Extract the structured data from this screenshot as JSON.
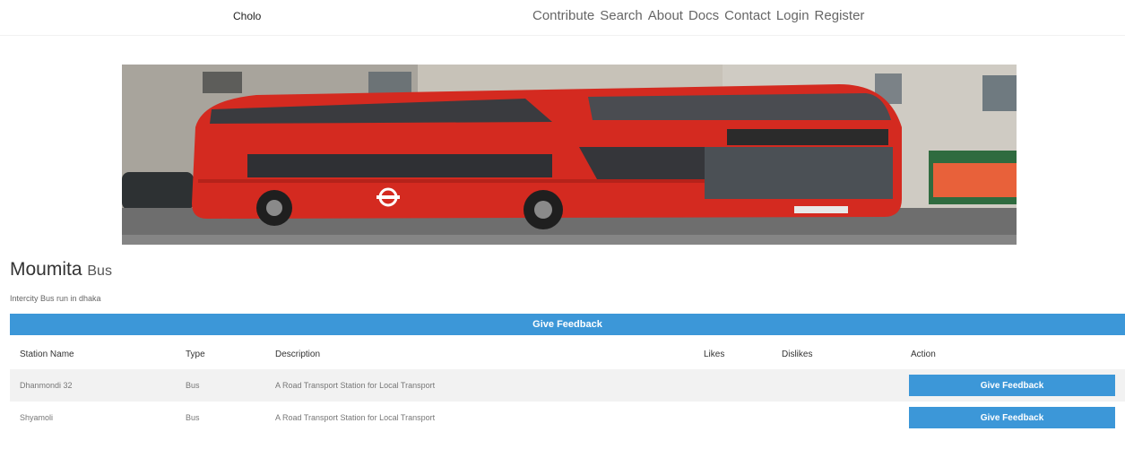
{
  "navbar": {
    "brand": "Cholo",
    "links": [
      "Contribute",
      "Search",
      "About",
      "Docs",
      "Contact",
      "Login",
      "Register"
    ]
  },
  "route": {
    "name": "Moumita",
    "type": "Bus",
    "description": "Intercity Bus run in dhaka"
  },
  "feedback_bar_label": "Give Feedback",
  "table": {
    "headers": [
      "Station Name",
      "Type",
      "Description",
      "Likes",
      "Dislikes",
      "Action"
    ],
    "rows": [
      {
        "station": "Dhanmondi 32",
        "type": "Bus",
        "description": "A Road Transport Station for Local Transport",
        "likes": "",
        "dislikes": "",
        "action": "Give Feedback"
      },
      {
        "station": "Shyamoli",
        "type": "Bus",
        "description": "A Road Transport Station for Local Transport",
        "likes": "",
        "dislikes": "",
        "action": "Give Feedback"
      }
    ]
  },
  "hero_image": {
    "subject": "red double-decker bus",
    "colors": {
      "bus": "#d42a20",
      "sky_building": "#bfbcb5",
      "road": "#6f6f6f"
    }
  },
  "colors": {
    "accent": "#3c97d8"
  }
}
